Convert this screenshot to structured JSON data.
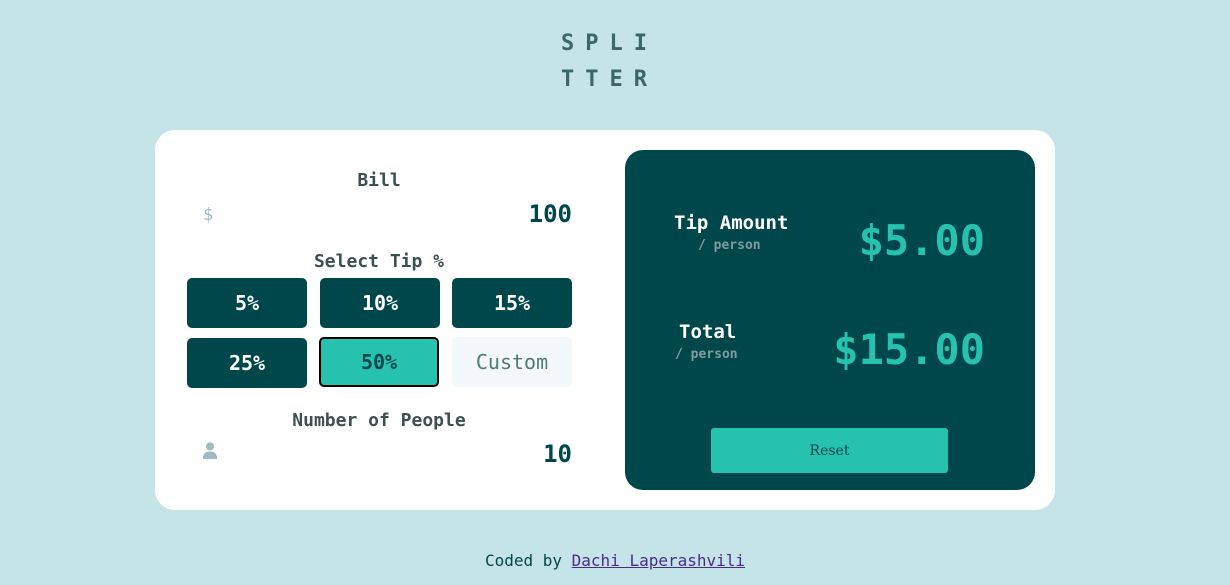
{
  "logo": {
    "line1": "SPLI",
    "line2": "TTER"
  },
  "bill": {
    "label": "Bill",
    "icon": "dollar-icon",
    "symbol": "$",
    "value": "100"
  },
  "tip": {
    "label": "Select Tip %",
    "options": [
      "5%",
      "10%",
      "15%",
      "25%",
      "50%"
    ],
    "selected": "50%",
    "custom_placeholder": "Custom"
  },
  "people": {
    "label": "Number of People",
    "icon": "person-icon",
    "value": "10"
  },
  "results": {
    "tip_label": "Tip Amount",
    "tip_sub": "/ person",
    "tip_value": "$5.00",
    "total_label": "Total",
    "total_sub": "/ person",
    "total_value": "$15.00",
    "reset_label": "Reset"
  },
  "footer": {
    "prefix": "Coded by",
    "author": "Dachi Laperashvili"
  },
  "colors": {
    "background": "#c5e4e7",
    "accent": "#26c2ae",
    "dark": "#00474b"
  }
}
